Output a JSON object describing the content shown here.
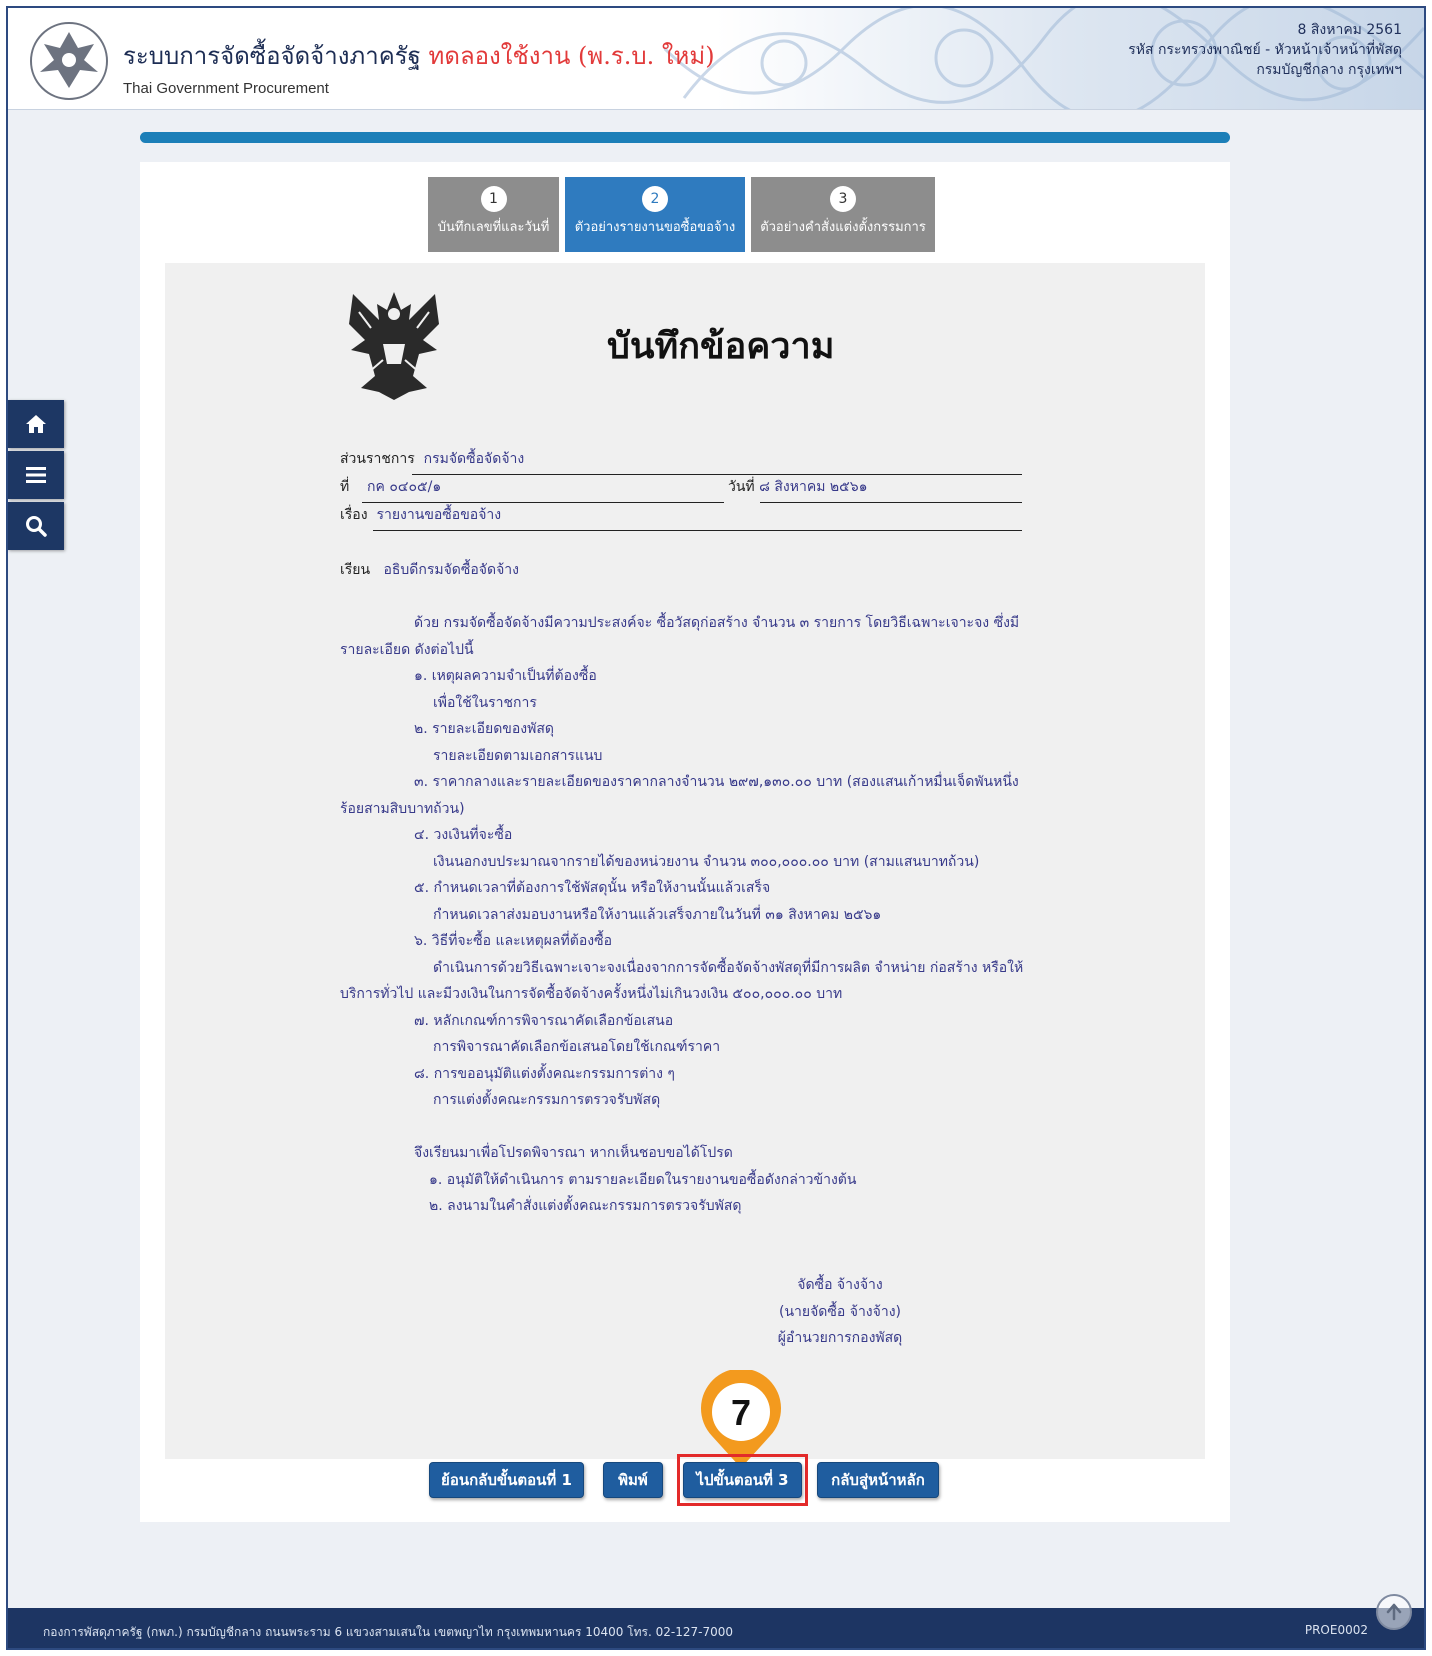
{
  "header": {
    "system_title": "ระบบการจัดซื้อจัดจ้างภาครัฐ",
    "trial_label": "ทดลองใช้งาน (พ.ร.บ. ใหม่)",
    "subtitle": "Thai Government Procurement",
    "date": "8 สิงหาคม 2561",
    "user_line1": "รหัส กระทรวงพาณิชย์ - หัวหน้าเจ้าหน้าที่พัสดุ",
    "user_line2": "กรมบัญชีกลาง กรุงเทพฯ"
  },
  "progress": {
    "fraction": 1.0
  },
  "sidebar": {
    "icons": [
      "home-icon",
      "menu-icon",
      "search-icon"
    ]
  },
  "steps": [
    {
      "num": "1",
      "label": "บันทึกเลขที่และวันที่",
      "active": false
    },
    {
      "num": "2",
      "label": "ตัวอย่างรายงานขอซื้อขอจ้าง",
      "active": true
    },
    {
      "num": "3",
      "label": "ตัวอย่างคำสั่งแต่งตั้งกรรมการ",
      "active": false
    }
  ],
  "document": {
    "title": "บันทึกข้อความ",
    "agency_label": "ส่วนราชการ",
    "agency_value": "กรมจัดซื้อจัดจ้าง",
    "ref_label": "ที่",
    "ref_value": "กค ๐๔๐๕/๑",
    "date_label": "วันที่",
    "date_value": "๘ สิงหาคม ๒๕๖๑",
    "subject_label": "เรื่อง",
    "subject_value": "รายงานขอซื้อขอจ้าง",
    "to_label": "เรียน",
    "to_value": "อธิบดีกรมจัดซื้อจัดจ้าง",
    "lines": [
      "ด้วย กรมจัดซื้อจัดจ้างมีความประสงค์จะ ซื้อวัสดุก่อสร้าง จำนวน ๓ รายการ โดยวิธีเฉพาะเจาะจง ซึ่งมี",
      "รายละเอียด ดังต่อไปนี้",
      "๑. เหตุผลความจำเป็นที่ต้องซื้อ",
      "เพื่อใช้ในราชการ",
      "๒. รายละเอียดของพัสดุ",
      "รายละเอียดตามเอกสารแนบ",
      "๓. ราคากลางและรายละเอียดของราคากลางจำนวน ๒๙๗,๑๓๐.๐๐ บาท (สองแสนเก้าหมื่นเจ็ดพันหนึ่ง",
      "ร้อยสามสิบบาทถ้วน)",
      "๔. วงเงินที่จะซื้อ",
      "เงินนอกงบประมาณจากรายได้ของหน่วยงาน จำนวน ๓๐๐,๐๐๐.๐๐ บาท (สามแสนบาทถ้วน)",
      "๕. กำหนดเวลาที่ต้องการใช้พัสดุนั้น หรือให้งานนั้นแล้วเสร็จ",
      "กำหนดเวลาส่งมอบงานหรือให้งานแล้วเสร็จภายในวันที่ ๓๑ สิงหาคม ๒๕๖๑",
      "๖. วิธีที่จะซื้อ และเหตุผลที่ต้องซื้อ",
      "ดำเนินการด้วยวิธีเฉพาะเจาะจงเนื่องจากการจัดซื้อจัดจ้างพัสดุที่มีการผลิต จำหน่าย ก่อสร้าง หรือให้",
      "บริการทั่วไป และมีวงเงินในการจัดซื้อจัดจ้างครั้งหนึ่งไม่เกินวงเงิน ๕๐๐,๐๐๐.๐๐ บาท",
      "๗. หลักเกณฑ์การพิจารณาคัดเลือกข้อเสนอ",
      "การพิจารณาคัดเลือกข้อเสนอโดยใช้เกณฑ์ราคา",
      "๘. การขออนุมัติแต่งตั้งคณะกรรมการต่าง ๆ",
      "การแต่งตั้งคณะกรรมการตรวจรับพัสดุ",
      "จึงเรียนมาเพื่อโปรดพิจารณา หากเห็นชอบขอได้โปรด",
      "๑. อนุมัติให้ดำเนินการ ตามรายละเอียดในรายงานขอซื้อดังกล่าวข้างต้น",
      "๒. ลงนามในคำสั่งแต่งตั้งคณะกรรมการตรวจรับพัสดุ"
    ],
    "signature": [
      "จัดซื้อ จ้างจ้าง",
      "(นายจัดซื้อ จ้างจ้าง)",
      "ผู้อำนวยการกองพัสดุ"
    ]
  },
  "buttons": {
    "back": "ย้อนกลับขั้นตอนที่ 1",
    "print": "พิมพ์",
    "next": "ไปขั้นตอนที่ 3",
    "home": "กลับสู่หน้าหลัก"
  },
  "callout_number": "7",
  "footer": {
    "address": "กองการพัสดุภาครัฐ (กพภ.) กรมบัญชีกลาง ถนนพระราม 6 แขวงสามเสนใน เขตพญาไท กรุงเทพมหานคร 10400 โทร. 02-127-7000",
    "code": "PROE0002"
  },
  "colors": {
    "navy": "#1d3563",
    "active_tab": "#2f7bbf",
    "inactive_tab": "#8d8d8d",
    "doc_text": "#383a8a",
    "callout": "#f39a1e",
    "highlight": "#e32a2a"
  }
}
